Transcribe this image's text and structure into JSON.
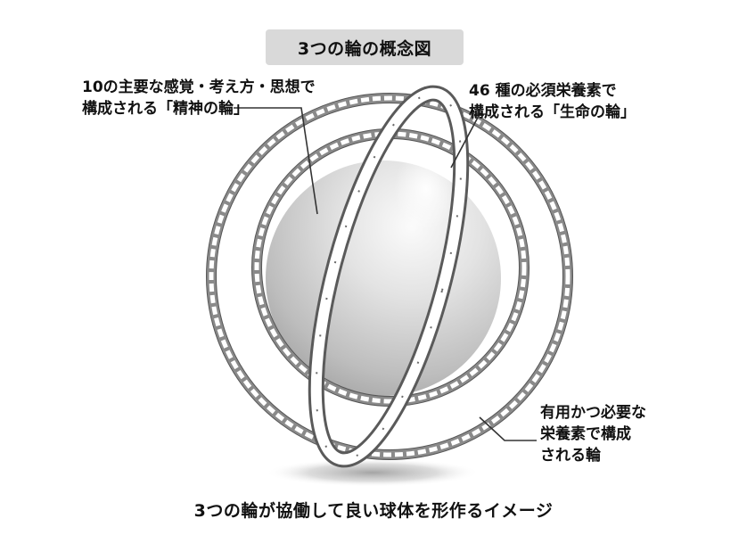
{
  "title": "3つの輪の概念図",
  "labels": {
    "spirit": {
      "line1": "10の主要な感覚・考え方・思想で",
      "line2": "構成される「精神の輪」"
    },
    "life": {
      "line1": "46 種の必須栄養素で",
      "line2": "構成される「生命の輪」"
    },
    "useful": {
      "line1": "有用かつ必要な",
      "line2": "栄養素で構成",
      "line3": "される輪"
    }
  },
  "caption": "3つの輪が協働して良い球体を形作るイメージ",
  "colors": {
    "chain": "#8a8a8a",
    "chain_dark": "#3a3a3a",
    "sphere_light": "#f4f4f4",
    "sphere_dark": "#9a9a9a",
    "title_bg": "#d9d9d9",
    "leader": "#333333"
  }
}
